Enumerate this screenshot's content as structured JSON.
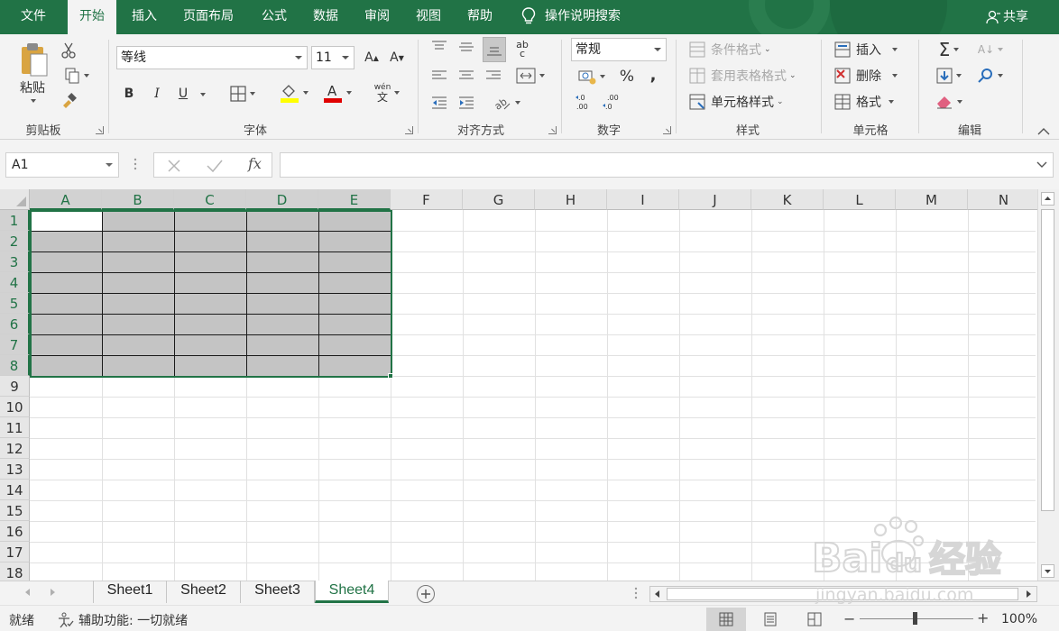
{
  "tabs": [
    "文件",
    "开始",
    "插入",
    "页面布局",
    "公式",
    "数据",
    "审阅",
    "视图",
    "帮助"
  ],
  "active_tab": "开始",
  "tell_me": "操作说明搜索",
  "share": "共享",
  "ribbon": {
    "clipboard": {
      "label": "剪贴板",
      "paste": "粘贴"
    },
    "font": {
      "label": "字体",
      "font_name": "等线",
      "font_size": "11",
      "bold": "B",
      "italic": "I",
      "underline": "U",
      "phonetic": "wén",
      "phonetic_char": "文",
      "fill_color": "#ffff00",
      "font_color": "#e00000"
    },
    "alignment": {
      "label": "对齐方式",
      "wrap_text": "ab",
      "wrap_text_2": "c"
    },
    "number": {
      "label": "数字",
      "format": "常规",
      "percent": "%",
      "comma": ","
    },
    "styles": {
      "label": "样式",
      "conditional": "条件格式",
      "format_table": "套用表格格式",
      "cell_styles": "单元格样式"
    },
    "cells": {
      "label": "单元格",
      "insert": "插入",
      "delete": "删除",
      "format": "格式"
    },
    "editing": {
      "label": "编辑"
    }
  },
  "formula_bar": {
    "name_box": "A1",
    "fx": "fx",
    "formula": ""
  },
  "grid": {
    "columns": [
      "A",
      "B",
      "C",
      "D",
      "E",
      "F",
      "G",
      "H",
      "I",
      "J",
      "K",
      "L",
      "M",
      "N"
    ],
    "rows": [
      "1",
      "2",
      "3",
      "4",
      "5",
      "6",
      "7",
      "8",
      "9",
      "10",
      "11",
      "12",
      "13",
      "14",
      "15",
      "16",
      "17",
      "18"
    ],
    "selection": "A1:E8",
    "selection_fill": "#c4c4c4",
    "accent": "#217346"
  },
  "sheets": [
    "Sheet1",
    "Sheet2",
    "Sheet3",
    "Sheet4"
  ],
  "active_sheet": "Sheet4",
  "status": {
    "ready": "就绪",
    "accessibility": "辅助功能: 一切就绪",
    "zoom": "100%"
  },
  "watermark": {
    "brand": "Bai",
    "brand_tail": "du",
    "brand_cn": "经验",
    "url": "jingyan.baidu.com"
  }
}
